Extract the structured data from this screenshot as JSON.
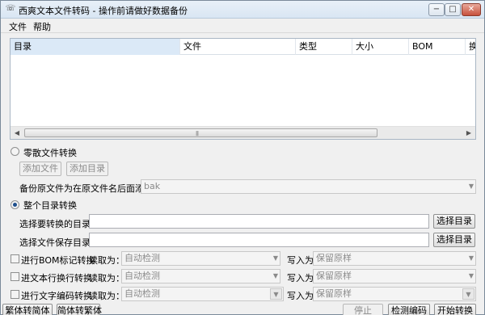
{
  "window": {
    "icon": "app-icon",
    "title": "西爽文本文件转码 - 操作前请做好数据备份",
    "min": "−",
    "max": "□",
    "close": "✕"
  },
  "menu": [
    "文件",
    "帮助"
  ],
  "list": {
    "columns": [
      "目录",
      "文件",
      "类型",
      "大小",
      "BOM",
      "换"
    ],
    "rows": []
  },
  "scatter": {
    "label": "零散文件转换",
    "selected": false,
    "add_file": "添加文件",
    "add_dir": "添加目录",
    "backup_label": "备份原文件为在原文件名后面添加：",
    "backup_value": "bak"
  },
  "whole": {
    "label": "整个目录转换",
    "selected": true,
    "src_label": "选择要转换的目录：",
    "src_value": "",
    "src_button": "选择目录",
    "dst_label": "选择文件保存目录：",
    "dst_value": "",
    "dst_button": "选择目录"
  },
  "options": [
    {
      "check": "进行BOM标记转换",
      "read_label": "读取为：",
      "read_value": "自动检测",
      "write_label": "写入为",
      "write_value": "保留原样"
    },
    {
      "check": "进文本行换行转换",
      "read_label": "读取为：",
      "read_value": "自动检测",
      "write_label": "写入为",
      "write_value": "保留原样"
    },
    {
      "check": "进行文字编码转换",
      "read_label": "读取为：",
      "read_value": "自动检测",
      "write_label": "写入为",
      "write_value": "保留原样"
    }
  ],
  "bottom": {
    "t2s": "繁体转简体",
    "s2t": "简体转繁体",
    "stop": "停止",
    "detect": "检测编码",
    "start": "开始转换"
  },
  "colors": {
    "accent": "#1e4f8c",
    "title_bg": "#dce8f4",
    "close_btn": "#c7513c"
  }
}
